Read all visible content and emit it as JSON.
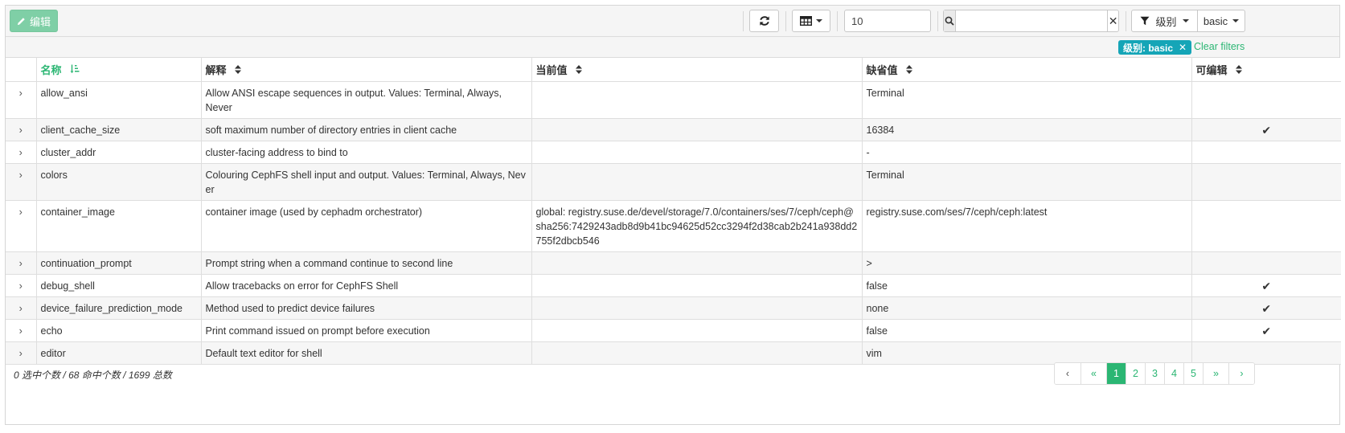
{
  "toolbar": {
    "edit_label": "编辑",
    "limit_value": "10",
    "search_value": "",
    "filter_field_label": "级别",
    "filter_value_label": "basic"
  },
  "filters": {
    "active_tag": "级别: basic",
    "clear_label": "Clear filters"
  },
  "table": {
    "columns": [
      "名称",
      "解释",
      "当前值",
      "缺省值",
      "可编辑"
    ],
    "sorted_column": "名称",
    "rows": [
      {
        "name": "allow_ansi",
        "desc": "Allow ANSI escape sequences in output. Values: Terminal, Always, Never",
        "current": "",
        "default": "Terminal",
        "editable": false
      },
      {
        "name": "client_cache_size",
        "desc": "soft maximum number of directory entries in client cache",
        "current": "",
        "default": "16384",
        "editable": true
      },
      {
        "name": "cluster_addr",
        "desc": "cluster-facing address to bind to",
        "current": "",
        "default": "-",
        "editable": false
      },
      {
        "name": "colors",
        "desc": "Colouring CephFS shell input and output. Values: Terminal, Always, Never",
        "current": "",
        "default": "Terminal",
        "editable": false
      },
      {
        "name": "container_image",
        "desc": "container image (used by cephadm orchestrator)",
        "current": "global: registry.suse.de/devel/storage/7.0/containers/ses/7/ceph/ceph@sha256:7429243adb8d9b41bc94625d52cc3294f2d38cab2b241a938dd2755f2dbcb546",
        "default": "registry.suse.com/ses/7/ceph/ceph:latest",
        "editable": false
      },
      {
        "name": "continuation_prompt",
        "desc": "Prompt string when a command continue to second line",
        "current": "",
        "default": ">",
        "editable": false
      },
      {
        "name": "debug_shell",
        "desc": "Allow tracebacks on error for CephFS Shell",
        "current": "",
        "default": "false",
        "editable": true
      },
      {
        "name": "device_failure_prediction_mode",
        "desc": "Method used to predict device failures",
        "current": "",
        "default": "none",
        "editable": true
      },
      {
        "name": "echo",
        "desc": "Print command issued on prompt before execution",
        "current": "",
        "default": "false",
        "editable": true
      },
      {
        "name": "editor",
        "desc": "Default text editor for shell",
        "current": "",
        "default": "vim",
        "editable": false
      }
    ]
  },
  "footer": {
    "selected": "0",
    "selected_label": "选中个数",
    "found": "68",
    "found_label": "命中个数",
    "total": "1699",
    "total_label": "总数"
  },
  "pagination": {
    "first": "‹",
    "prev": "«",
    "pages": [
      "1",
      "2",
      "3",
      "4",
      "5"
    ],
    "active": "1",
    "next": "»",
    "last": "›"
  },
  "colors": {
    "accent": "#2bb673",
    "tag": "#15a5b7",
    "edit_button": "#7fcfa6"
  }
}
